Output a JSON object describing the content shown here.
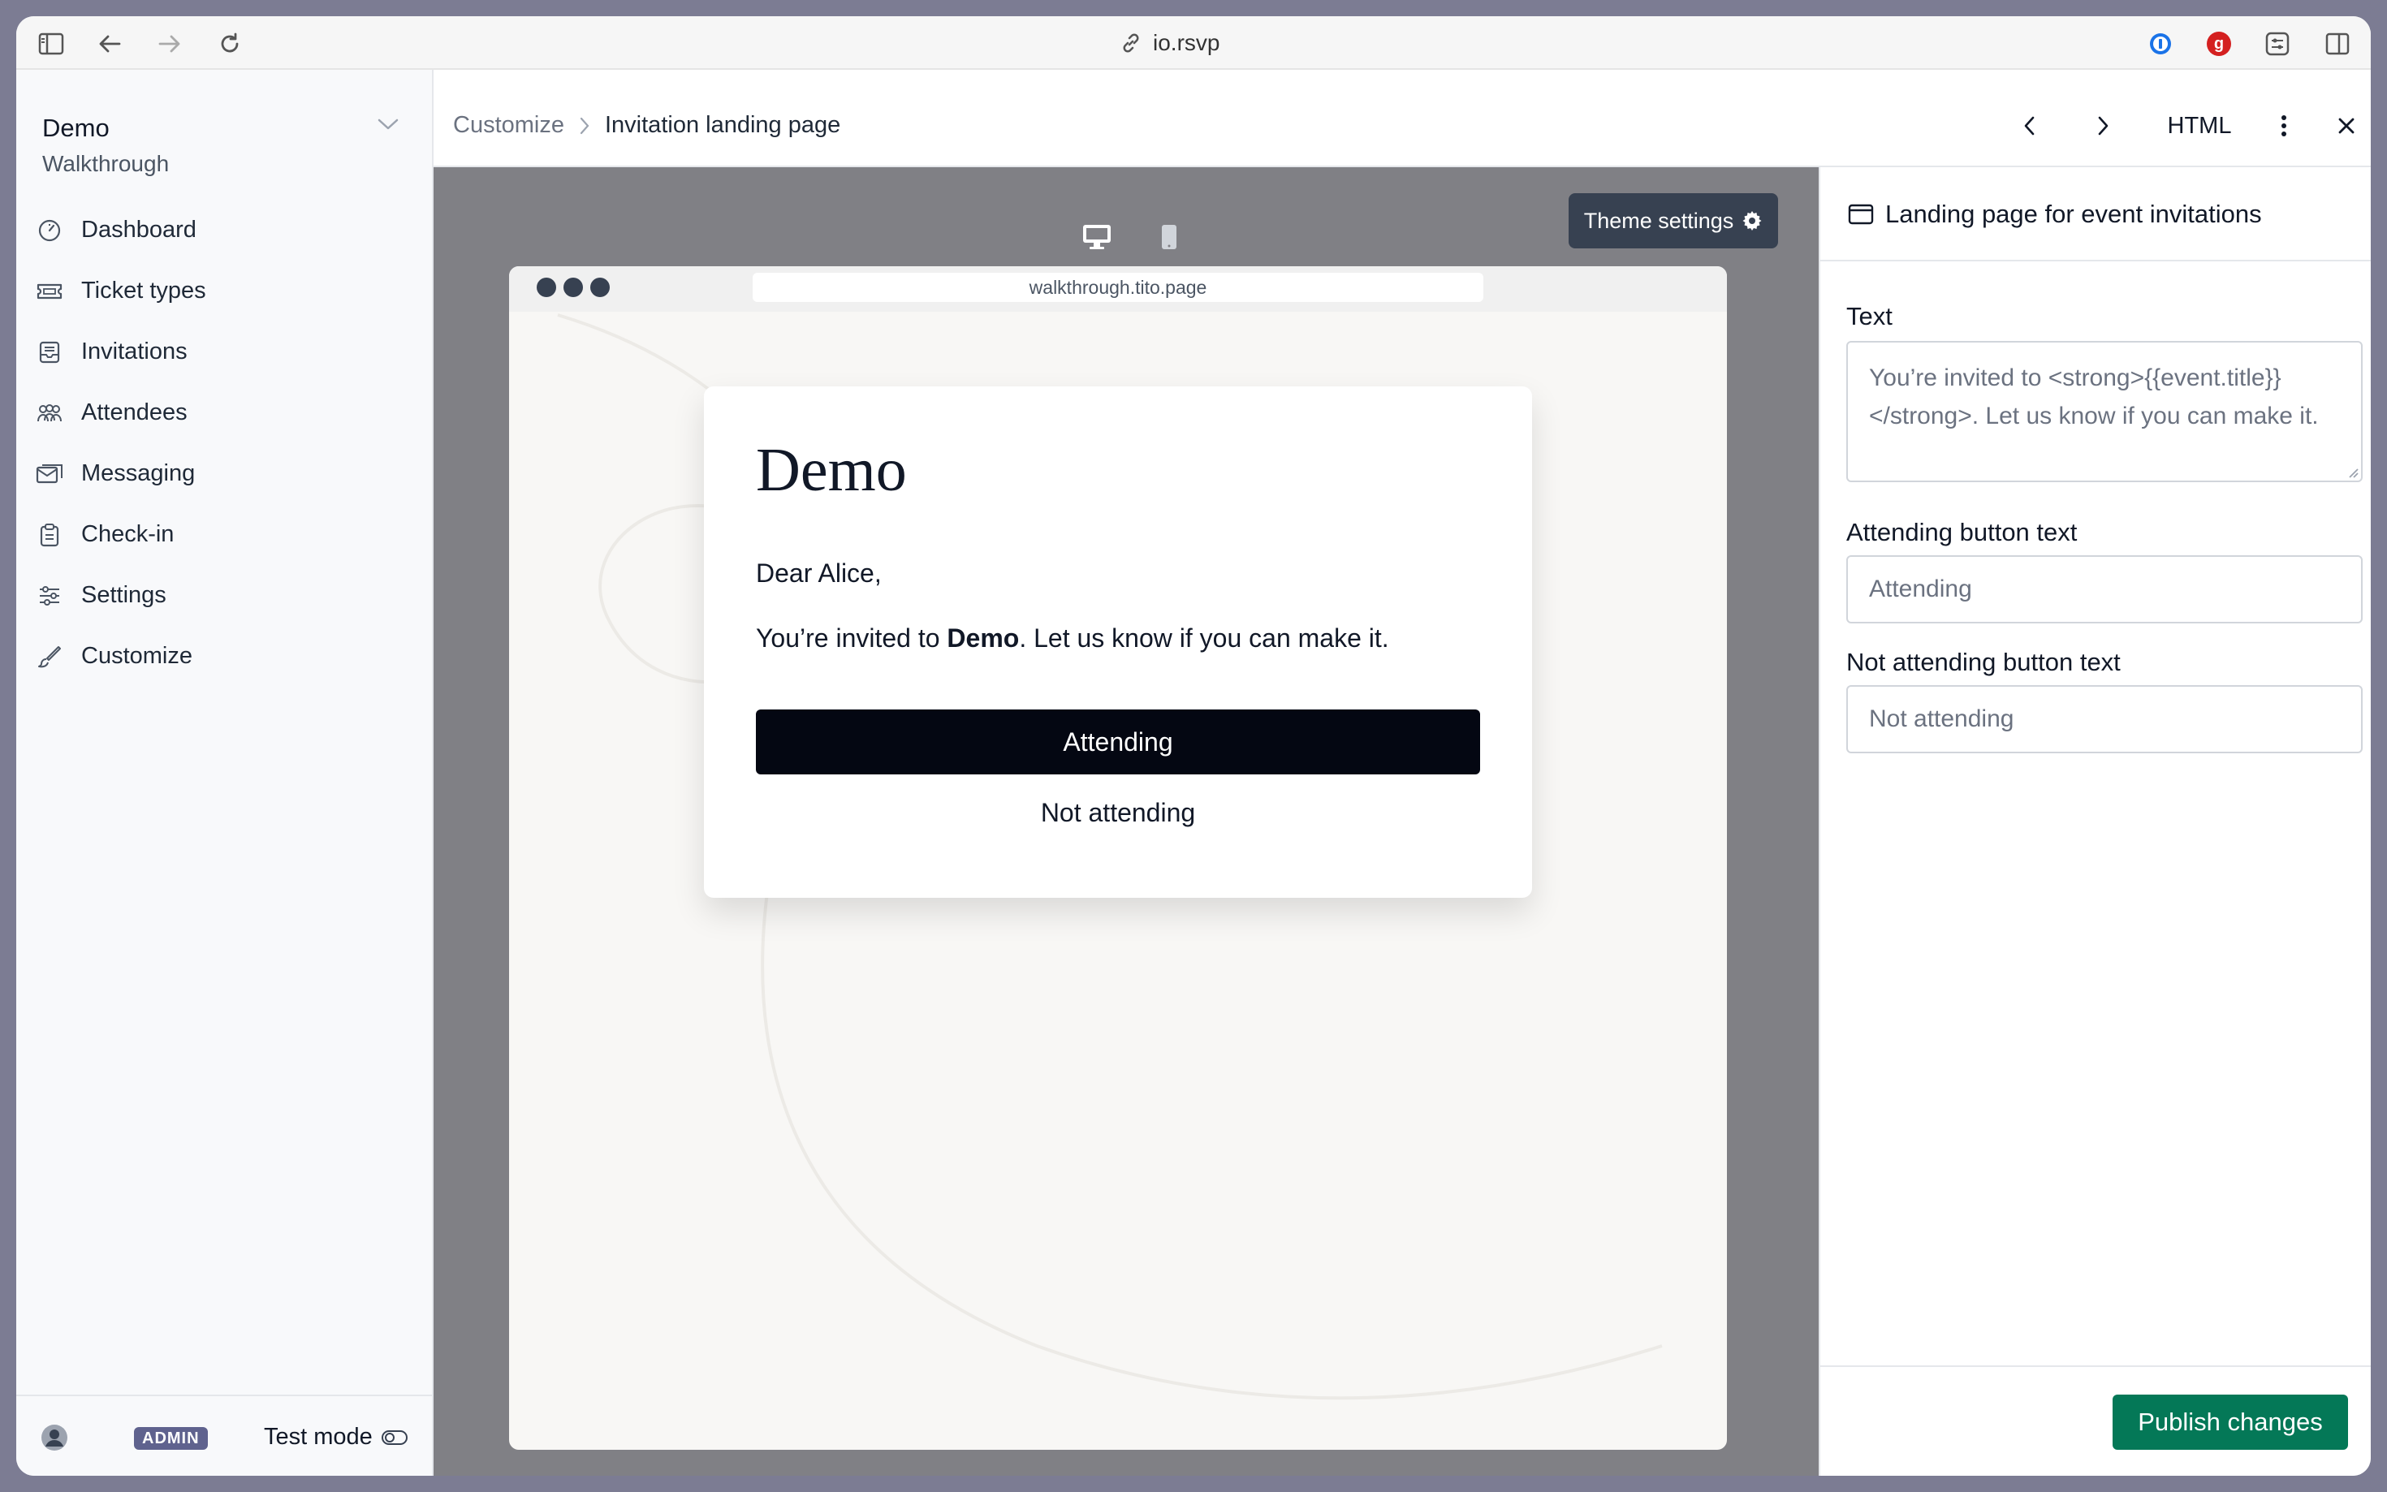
{
  "browser": {
    "url": "io.rsvp"
  },
  "sidebar": {
    "org_name": "Demo",
    "org_subtitle": "Walkthrough",
    "items": [
      {
        "label": "Dashboard",
        "icon": "dashboard-icon"
      },
      {
        "label": "Ticket types",
        "icon": "ticket-icon"
      },
      {
        "label": "Invitations",
        "icon": "inbox-icon"
      },
      {
        "label": "Attendees",
        "icon": "people-icon"
      },
      {
        "label": "Messaging",
        "icon": "mail-icon"
      },
      {
        "label": "Check-in",
        "icon": "clipboard-icon"
      },
      {
        "label": "Settings",
        "icon": "sliders-icon"
      },
      {
        "label": "Customize",
        "icon": "brush-icon"
      }
    ],
    "footer": {
      "badge": "ADMIN",
      "test_mode": "Test mode"
    }
  },
  "topbar": {
    "breadcrumb_parent": "Customize",
    "breadcrumb_current": "Invitation landing page",
    "html_label": "HTML"
  },
  "preview": {
    "theme_settings": "Theme settings",
    "mock_url": "walkthrough.tito.page",
    "card": {
      "title": "Demo",
      "greeting": "Dear Alice,",
      "msg_prefix": "You’re invited to ",
      "msg_strong": "Demo",
      "msg_suffix": ". Let us know if you can make it.",
      "attending": "Attending",
      "not_attending": "Not attending"
    }
  },
  "panel": {
    "title": "Landing page for event invitations",
    "text_label": "Text",
    "text_value": "You’re invited to <strong>{{event.title}}</strong>. Let us know if you can make it.",
    "attending_label": "Attending button text",
    "attending_value": "Attending",
    "not_attending_label": "Not attending button text",
    "not_attending_value": "Not attending",
    "publish": "Publish changes"
  },
  "colors": {
    "publish": "#047857",
    "attend_button": "#040712",
    "admin_badge": "#5f628e"
  }
}
